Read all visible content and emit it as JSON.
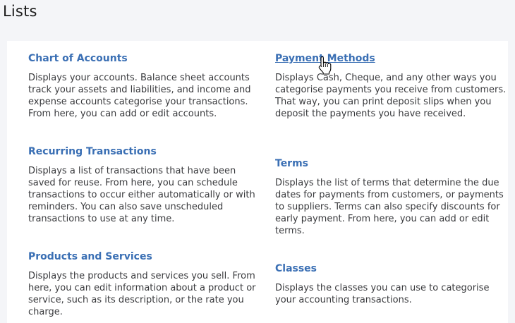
{
  "page": {
    "title": "Lists"
  },
  "items": [
    {
      "title": "Chart of Accounts",
      "description": "Displays your accounts. Balance sheet accounts track your assets and liabilities, and income and expense accounts categorise your transactions. From here, you can add or edit accounts."
    },
    {
      "title": "Payment Methods",
      "description": "Displays Cash, Cheque, and any other ways you categorise payments you receive from customers. That way, you can print deposit slips when you deposit the payments you have received."
    },
    {
      "title": "Recurring Transactions",
      "description": "Displays a list of transactions that have been saved for reuse. From here, you can schedule transactions to occur either automatically or with reminders. You can also save unscheduled transactions to use at any time."
    },
    {
      "title": "Terms",
      "description": "Displays the list of terms that determine the due dates for payments from customers, or payments to suppliers. Terms can also specify discounts for early payment. From here, you can add or edit terms."
    },
    {
      "title": "Products and Services",
      "description": "Displays the products and services you sell. From here, you can edit information about a product or service, such as its description, or the rate you charge."
    },
    {
      "title": "Classes",
      "description": "Displays the classes you can use to categorise your accounting transactions."
    }
  ],
  "colors": {
    "link": "#3a6fb4",
    "text": "#393a3d",
    "background": "#f4f5f8",
    "panel": "#ffffff"
  },
  "cursor": {
    "icon": "hand-pointer-icon"
  }
}
